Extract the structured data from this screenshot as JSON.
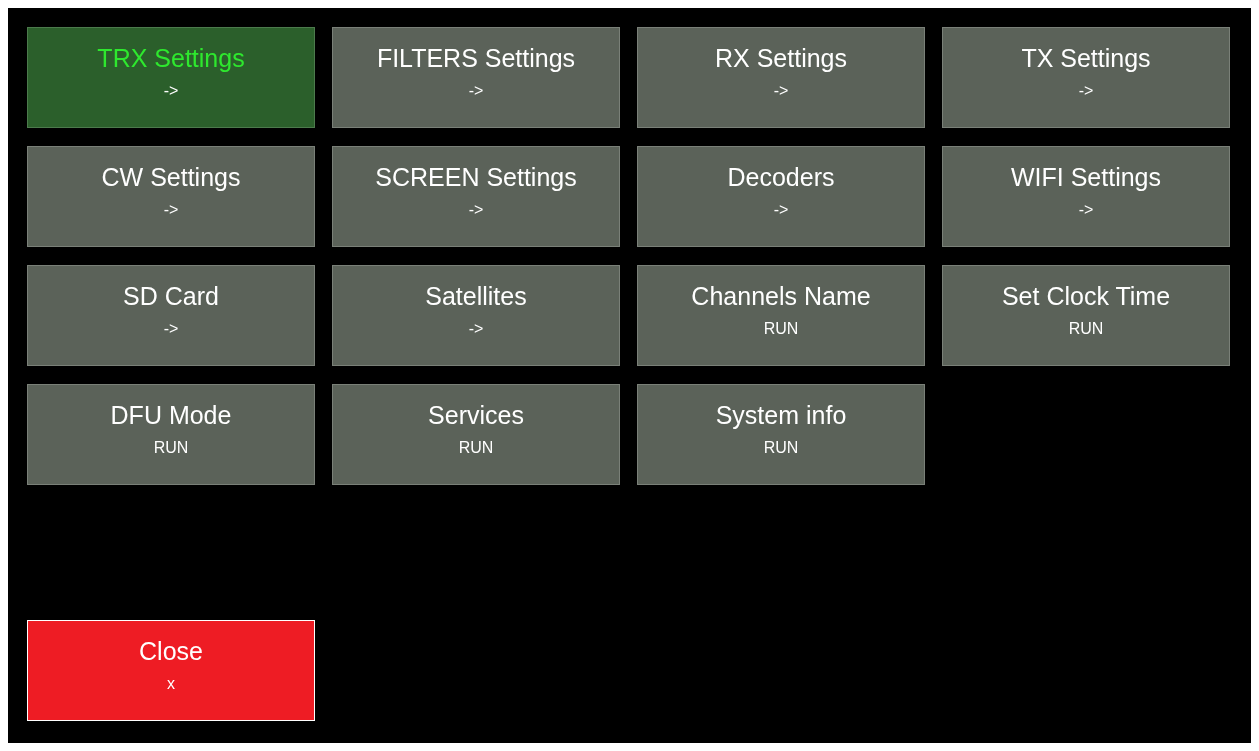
{
  "menu": [
    {
      "title": "TRX Settings",
      "action": "->",
      "selected": true
    },
    {
      "title": "FILTERS Settings",
      "action": "->",
      "selected": false
    },
    {
      "title": "RX Settings",
      "action": "->",
      "selected": false
    },
    {
      "title": "TX Settings",
      "action": "->",
      "selected": false
    },
    {
      "title": "CW Settings",
      "action": "->",
      "selected": false
    },
    {
      "title": "SCREEN Settings",
      "action": "->",
      "selected": false
    },
    {
      "title": "Decoders",
      "action": "->",
      "selected": false
    },
    {
      "title": "WIFI Settings",
      "action": "->",
      "selected": false
    },
    {
      "title": "SD Card",
      "action": "->",
      "selected": false
    },
    {
      "title": "Satellites",
      "action": "->",
      "selected": false
    },
    {
      "title": "Channels Name",
      "action": "RUN",
      "selected": false
    },
    {
      "title": "Set Clock Time",
      "action": "RUN",
      "selected": false
    },
    {
      "title": "DFU Mode",
      "action": "RUN",
      "selected": false
    },
    {
      "title": "Services",
      "action": "RUN",
      "selected": false
    },
    {
      "title": "System info",
      "action": "RUN",
      "selected": false
    }
  ],
  "close": {
    "title": "Close",
    "action": "x"
  }
}
